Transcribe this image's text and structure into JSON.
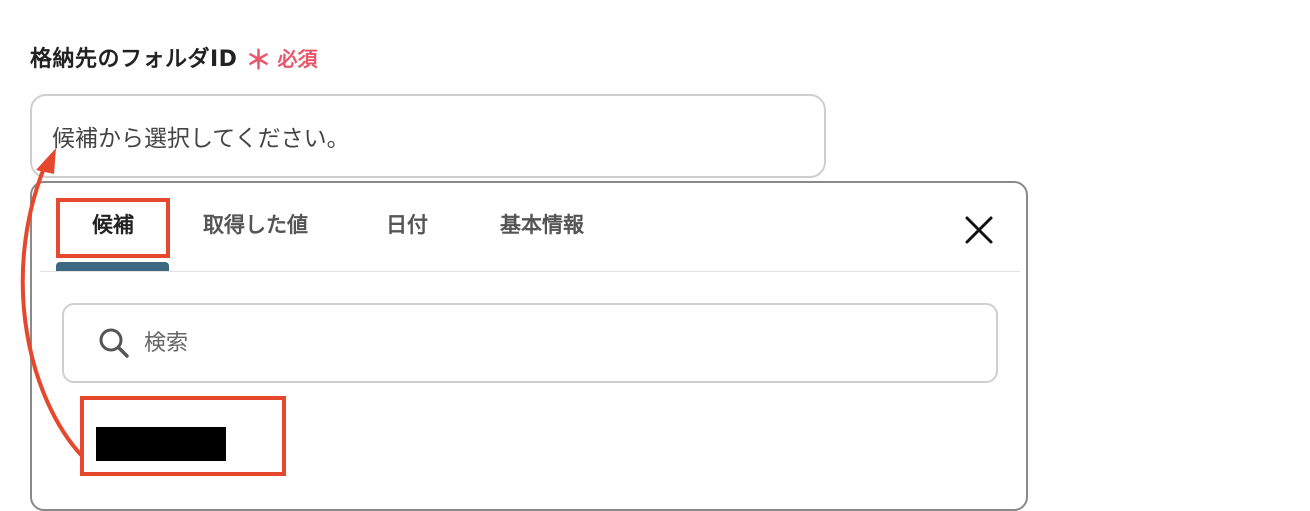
{
  "field": {
    "label": "格納先のフォルダID",
    "required_mark": "＊",
    "required_text": "必須"
  },
  "select_box": {
    "value": "候補から選択してください。"
  },
  "popup": {
    "tabs": [
      {
        "label": "候補",
        "active": true
      },
      {
        "label": "取得した値",
        "active": false
      },
      {
        "label": "日付",
        "active": false
      },
      {
        "label": "基本情報",
        "active": false
      }
    ],
    "close_icon": "close-icon",
    "search": {
      "placeholder": "検索",
      "icon": "search-icon"
    },
    "list": [
      {
        "label": "[redacted]"
      }
    ]
  },
  "colors": {
    "required": "#e8566a",
    "annotation": "#e5482c",
    "tab_underline": "#3c6882"
  }
}
